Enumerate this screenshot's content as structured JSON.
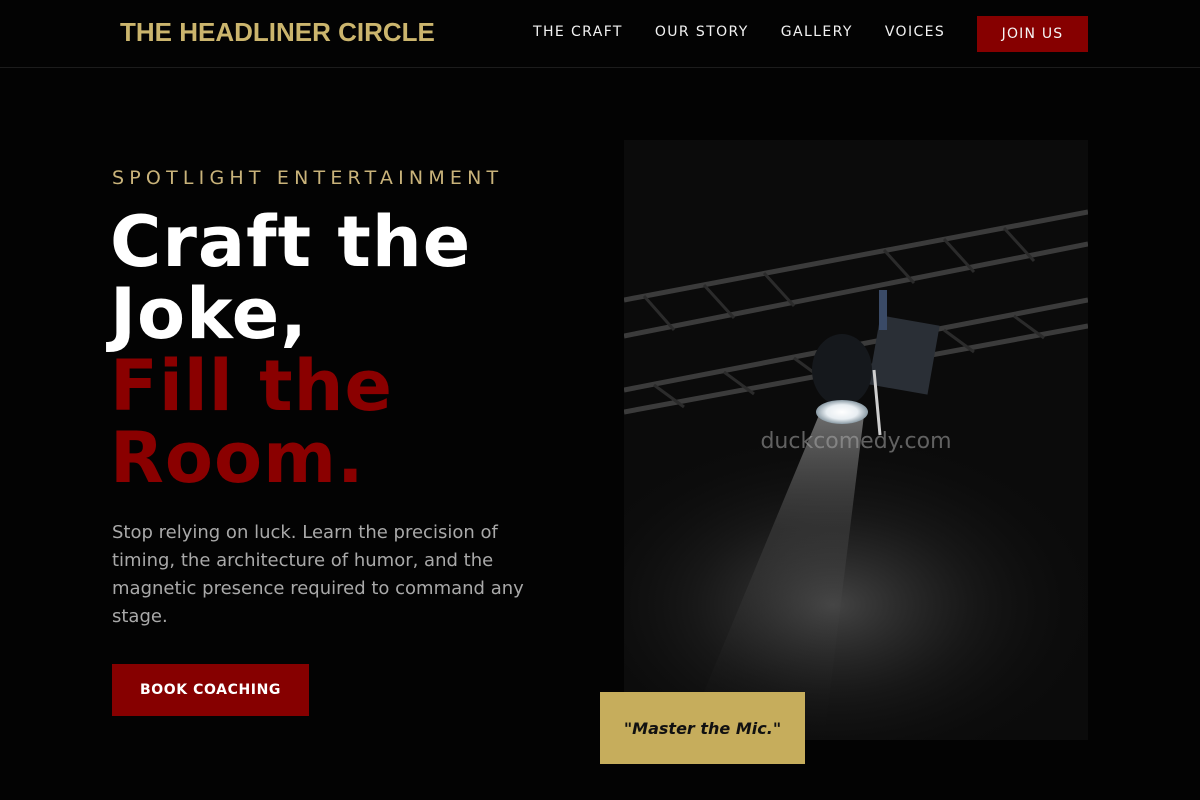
{
  "header": {
    "logo": "THE HEADLINER CIRCLE",
    "nav": [
      "THE CRAFT",
      "OUR STORY",
      "GALLERY",
      "VOICES"
    ],
    "cta": "JOIN US"
  },
  "hero": {
    "eyebrow": "SPOTLIGHT ENTERTAINMENT",
    "headline_white": [
      "Craft the",
      "Joke,"
    ],
    "headline_red": [
      "Fill the",
      "Room."
    ],
    "lead": "Stop relying on luck. Learn the precision of timing, the architecture of humor, and the magnetic presence required to command any stage.",
    "cta": "BOOK COACHING",
    "image_watermark": "duckcomedy.com",
    "quote": "\"Master the Mic.\""
  },
  "colors": {
    "background": "#030303",
    "gold": "#cbb56d",
    "accent_red": "#860000",
    "quote_card": "#c6ad5c"
  },
  "icons": {
    "hero_image": "stage-spotlight-truss-photo"
  }
}
